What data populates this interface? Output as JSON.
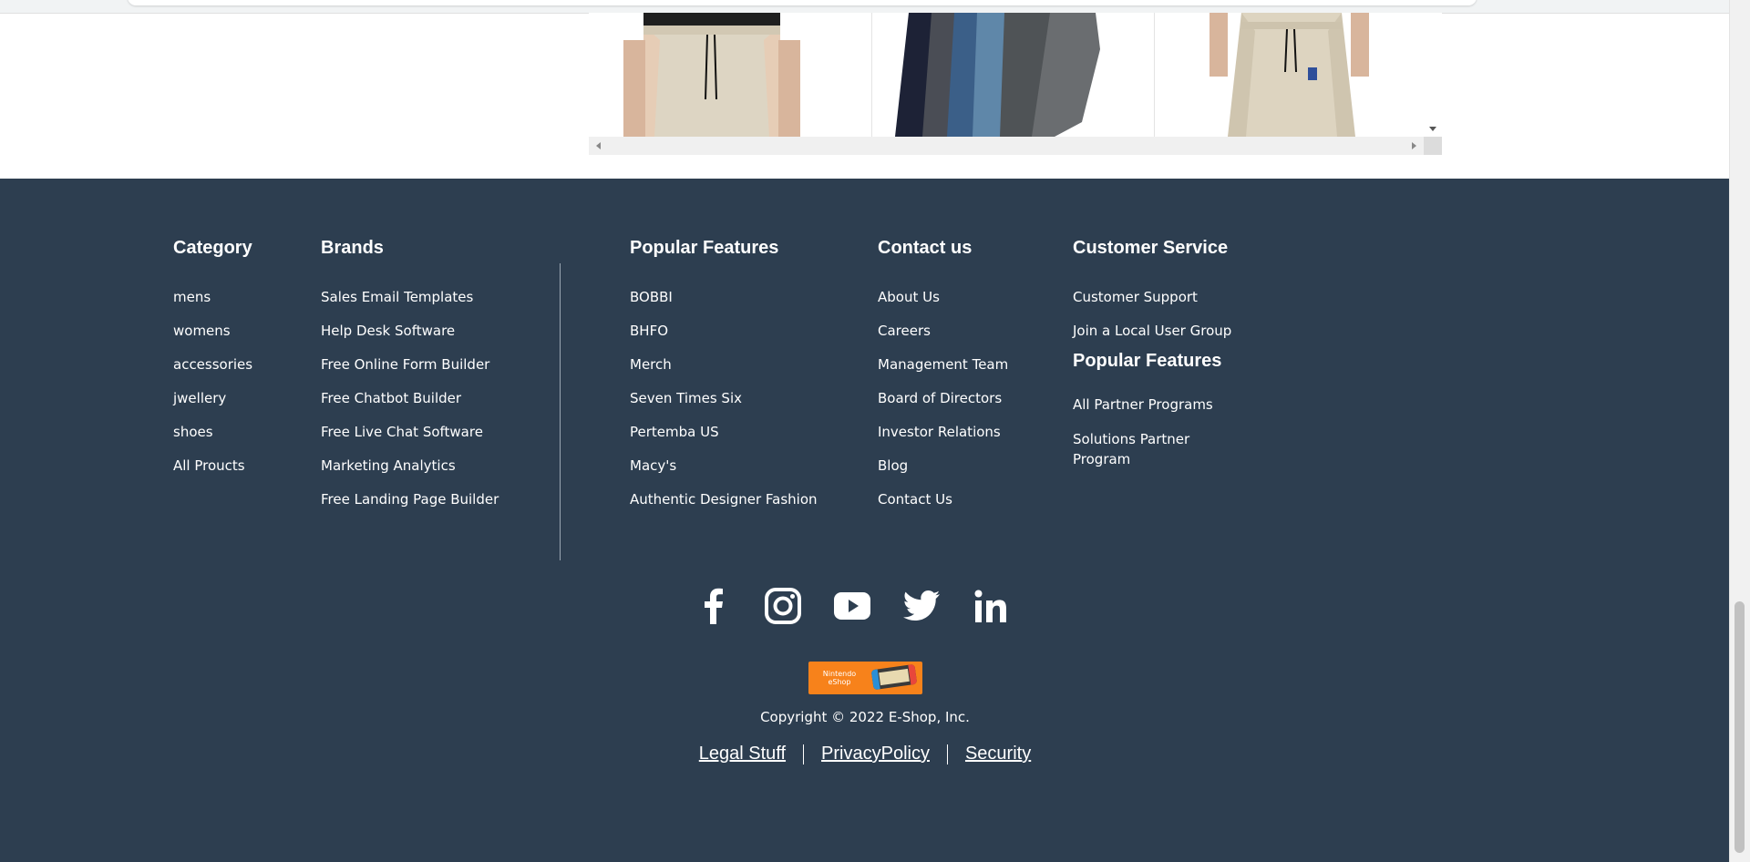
{
  "footer": {
    "columns": [
      {
        "heading": "Category",
        "items": [
          "mens",
          "womens",
          "accessories",
          "jwellery",
          "shoes",
          "All Proucts"
        ]
      },
      {
        "heading": "Brands",
        "items": [
          "Sales Email Templates",
          "Help Desk Software",
          "Free Online Form Builder",
          "Free Chatbot Builder",
          "Free Live Chat Software",
          "Marketing Analytics",
          "Free Landing Page Builder"
        ]
      },
      {
        "heading": "Popular Features",
        "items": [
          "BOBBI",
          "BHFO",
          "Merch",
          "Seven Times Six",
          "Pertemba US",
          "Macy's",
          "Authentic Designer Fashion"
        ]
      },
      {
        "heading": "Contact us",
        "items": [
          "About Us",
          "Careers",
          "Management Team",
          "Board of Directors",
          "Investor Relations",
          "Blog",
          "Contact Us"
        ]
      },
      {
        "heading": "Customer Service",
        "items": [
          "Customer Support",
          "Join a Local User Group"
        ],
        "sub_heading": "Popular Features",
        "sub_items": [
          "All Partner Programs",
          "Solutions Partner Program"
        ]
      }
    ],
    "social": [
      "facebook-icon",
      "instagram-icon",
      "youtube-icon",
      "twitter-icon",
      "linkedin-icon"
    ],
    "badge_text": "Nintendo eShop",
    "copyright": "Copyright © 2022 E-Shop, Inc.",
    "legal_links": [
      "Legal Stuff",
      "PrivacyPolicy",
      "Security"
    ]
  },
  "colors": {
    "footer_bg": "#2d3e50",
    "footer_text": "#ffffff",
    "badge": "#f7821b"
  }
}
